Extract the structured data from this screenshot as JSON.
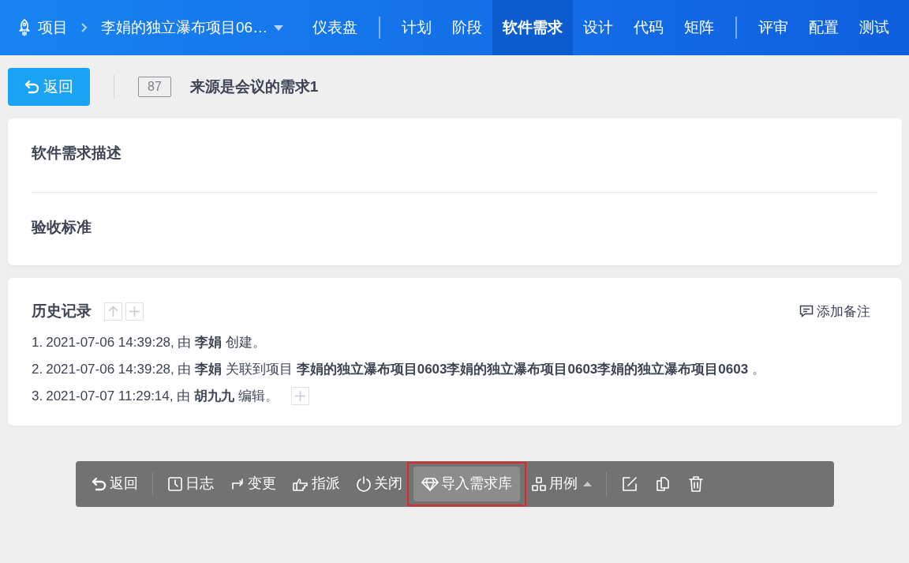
{
  "header": {
    "crumb_root": "项目",
    "project": "李娟的独立瀑布项目06…",
    "nav_groups": [
      [
        {
          "label": "仪表盘",
          "selected": false
        }
      ],
      [
        {
          "label": "计划",
          "selected": false
        },
        {
          "label": "阶段",
          "selected": false
        },
        {
          "label": "软件需求",
          "selected": true
        },
        {
          "label": "设计",
          "selected": false
        },
        {
          "label": "代码",
          "selected": false
        },
        {
          "label": "矩阵",
          "selected": false
        }
      ],
      [
        {
          "label": "评审",
          "selected": false
        },
        {
          "label": "配置",
          "selected": false
        },
        {
          "label": "测试",
          "selected": false
        }
      ]
    ]
  },
  "title_bar": {
    "back": "返回",
    "id": "87",
    "title": "来源是会议的需求1"
  },
  "sections": [
    {
      "heading": "软件需求描述"
    },
    {
      "heading": "验收标准"
    }
  ],
  "history": {
    "heading": "历史记录",
    "add_note": "添加备注",
    "entries": [
      {
        "number": "1.",
        "text": "2021-07-06 14:39:28, 由 **李娟** 创建。",
        "expandable": false
      },
      {
        "number": "2.",
        "text": "2021-07-06 14:39:28, 由 **李娟** 关联到项目 **李娟的独立瀑布项目0603李娟的独立瀑布项目0603李娟的独立瀑布项目0603** 。",
        "expandable": false
      },
      {
        "number": "3.",
        "text": "2021-07-07 11:29:14, 由 **胡九九** 编辑。",
        "expandable": true
      }
    ]
  },
  "toolbar": [
    [
      {
        "label": "返回",
        "highlighted": false
      }
    ],
    [
      {
        "label": "日志",
        "highlighted": false
      },
      {
        "label": "变更",
        "highlighted": false
      },
      {
        "label": "指派",
        "highlighted": false
      },
      {
        "label": "关闭",
        "highlighted": false
      },
      {
        "label": "导入需求库",
        "highlighted": true
      },
      {
        "label": "用例",
        "highlighted": false,
        "dropdown": true
      }
    ],
    [
      {
        "highlighted": false
      },
      {
        "highlighted": false
      },
      {
        "highlighted": false
      }
    ]
  ]
}
